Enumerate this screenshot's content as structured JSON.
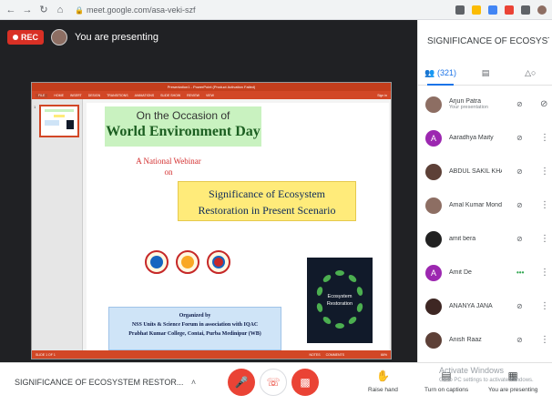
{
  "browser": {
    "url": "meet.google.com/asa-veki-szf",
    "back_icon": "arrow-left-icon",
    "forward_icon": "arrow-right-icon",
    "reload_icon": "reload-icon",
    "home_icon": "home-icon"
  },
  "stage": {
    "rec_label": "REC",
    "presenting_text": "You are presenting"
  },
  "ppt": {
    "window_title": "Presentation1 - PowerPoint (Product Activation Failed)",
    "ribbon_tabs": [
      "FILE",
      "HOME",
      "INSERT",
      "DESIGN",
      "TRANSITIONS",
      "ANIMATIONS",
      "SLIDE SHOW",
      "REVIEW",
      "VIEW"
    ],
    "sign_in": "Sign in",
    "slide_number": "1",
    "status_left": "SLIDE 1 OF 1",
    "status_notes": "NOTES",
    "status_comments": "COMMENTS",
    "zoom": "66%"
  },
  "slide": {
    "occasion_line1": "On the Occasion of",
    "occasion_line2": "World Environment Day",
    "national": "A National Webinar",
    "on": "on",
    "topic_line1": "Significance of Ecosystem",
    "topic_line2": "Restoration in Present Scenario",
    "organized_by": "Organized by",
    "org_line1": "NSS Units & Science Forum in association with IQAC",
    "org_line2": "Prabhat Kumar College, Contai, Purba Medinipur (WB)",
    "eco_logo_text": "Ecosystem Restoration"
  },
  "panel": {
    "title": "SIGNIFICANCE OF ECOSYSTEM R...",
    "people_count": "(321)",
    "people_tab_icon": "people-icon",
    "chat_tab_icon": "chat-icon",
    "activities_tab_icon": "activities-icon",
    "participants": [
      {
        "name": "Arjun Patra",
        "sub": "Your presentation",
        "initial": "",
        "avatar": "photo",
        "mic": "muted"
      },
      {
        "name": "Aaradhya Maity",
        "sub": "",
        "initial": "A",
        "avatar": "purple",
        "mic": "muted"
      },
      {
        "name": "ABDUL SAKIL KHAN",
        "sub": "",
        "initial": "",
        "avatar": "photo2",
        "mic": "muted"
      },
      {
        "name": "Amal Kumar Mondal Fa...",
        "sub": "",
        "initial": "",
        "avatar": "photo",
        "mic": "muted"
      },
      {
        "name": "amit bera",
        "sub": "",
        "initial": "",
        "avatar": "photo4",
        "mic": "muted"
      },
      {
        "name": "Amit De",
        "sub": "",
        "initial": "A",
        "avatar": "purple",
        "mic": "speaking"
      },
      {
        "name": "ANANYA JANA",
        "sub": "",
        "initial": "",
        "avatar": "photo3",
        "mic": "muted"
      },
      {
        "name": "Anish Raaz",
        "sub": "",
        "initial": "",
        "avatar": "photo2",
        "mic": "muted"
      }
    ]
  },
  "bottom": {
    "meeting_name": "SIGNIFICANCE OF ECOSYSTEM RESTOR...",
    "raise_hand": "Raise hand",
    "captions": "Turn on captions",
    "presenting": "You are presenting",
    "watermark_line1": "Activate Windows",
    "watermark_line2": "Go to PC settings to activate Windows."
  }
}
